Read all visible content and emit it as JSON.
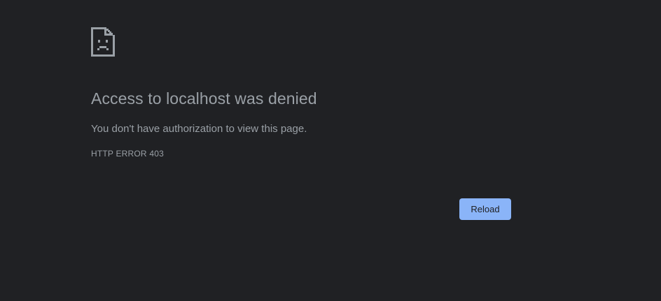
{
  "error": {
    "icon": "sad-document-icon",
    "title": "Access to localhost was denied",
    "message": "You don't have authorization to view this page.",
    "code": "HTTP ERROR 403"
  },
  "actions": {
    "reload_label": "Reload"
  },
  "colors": {
    "background": "#202124",
    "text": "#9aa0a6",
    "button": "#8ab4f8",
    "button_text": "#202124"
  }
}
